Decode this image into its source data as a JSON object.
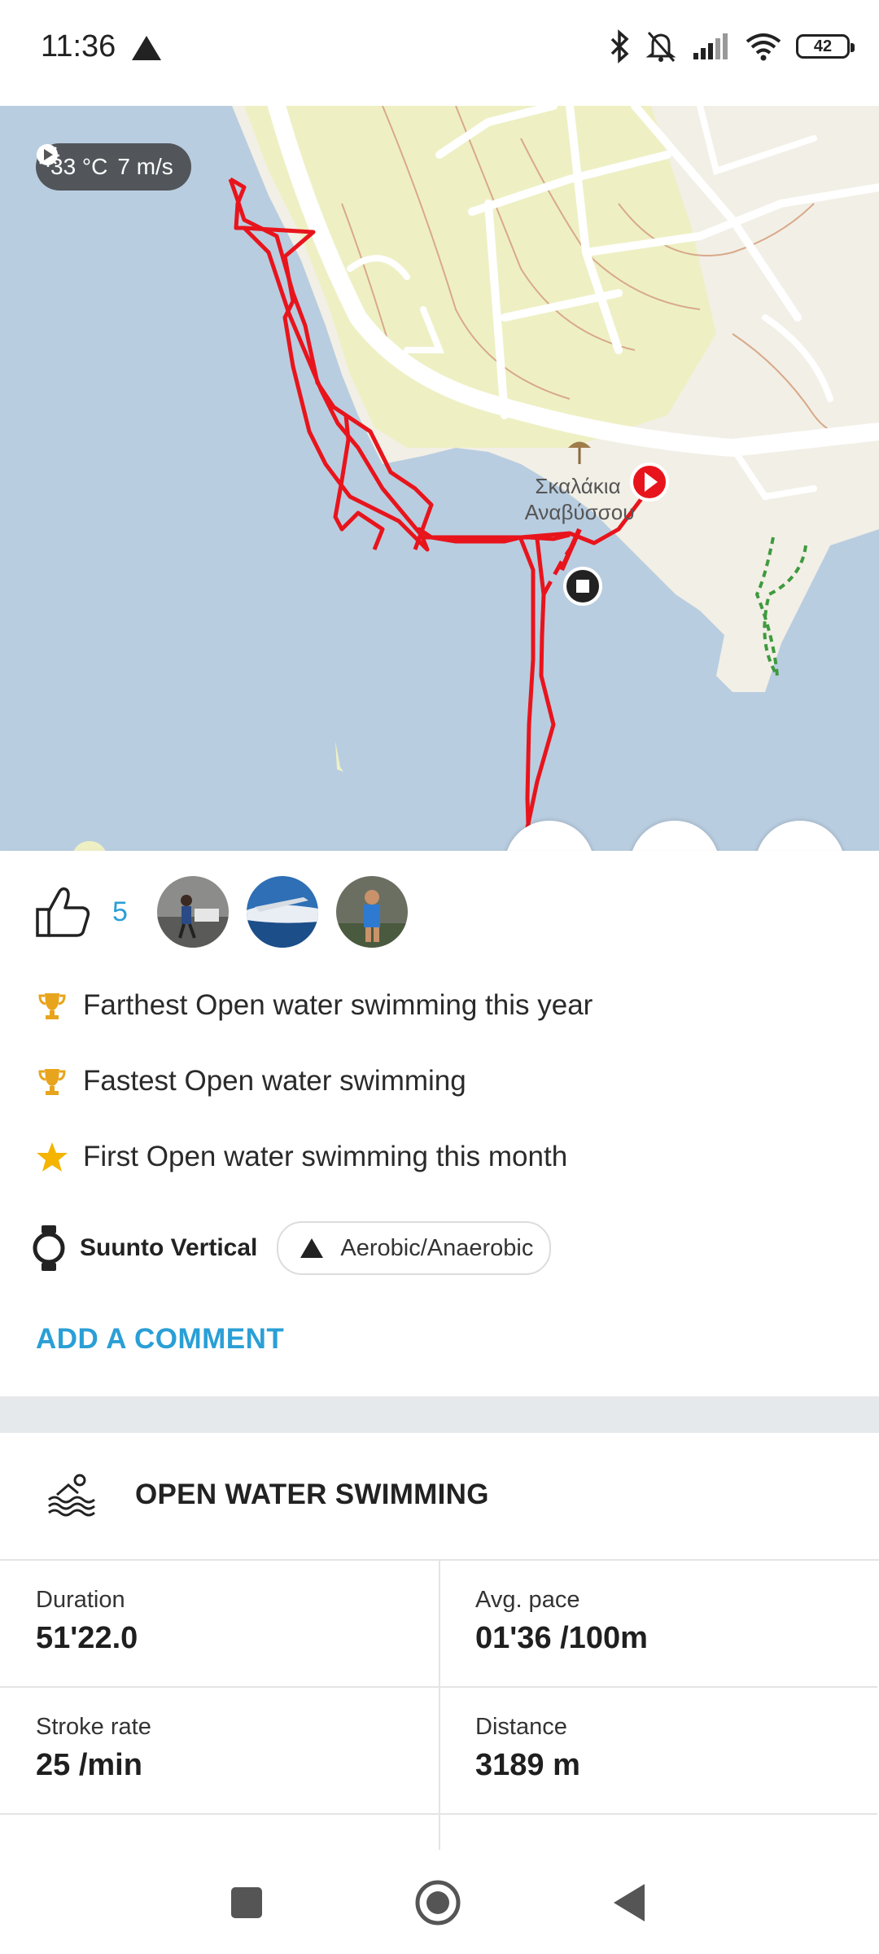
{
  "status_bar": {
    "time": "11:36",
    "battery": "42",
    "icons": [
      "navigation-arrow-icon",
      "bluetooth-icon",
      "bell-off-icon",
      "signal-icon",
      "wifi-icon",
      "battery-icon"
    ]
  },
  "map": {
    "weather": {
      "temperature": "33 °C",
      "wind": "7 m/s"
    },
    "place_label_line1": "Σκαλάκια",
    "place_label_line2": "Αναβύσσου",
    "route_color": "#e8141c",
    "water_color": "#b9cde0",
    "land_color": "#f2efe6"
  },
  "likes": {
    "count": "5"
  },
  "achievements": [
    {
      "icon": "trophy-icon",
      "text": "Farthest Open water swimming this year"
    },
    {
      "icon": "trophy-icon",
      "text": "Fastest Open water swimming"
    },
    {
      "icon": "star-icon",
      "text": "First Open water swimming this month"
    }
  ],
  "device": {
    "name": "Suunto Vertical",
    "tag": "Aerobic/Anaerobic"
  },
  "actions": {
    "add_comment": "ADD A COMMENT"
  },
  "summary": {
    "title": "OPEN WATER SWIMMING",
    "stats": [
      {
        "label": "Duration",
        "value": "51'22.0"
      },
      {
        "label": "Avg. pace",
        "value": "01'36 /100m"
      },
      {
        "label": "Stroke rate",
        "value": "25 /min"
      },
      {
        "label": "Distance",
        "value": "3189 m"
      }
    ]
  },
  "accent_color": "#2a9fd6"
}
